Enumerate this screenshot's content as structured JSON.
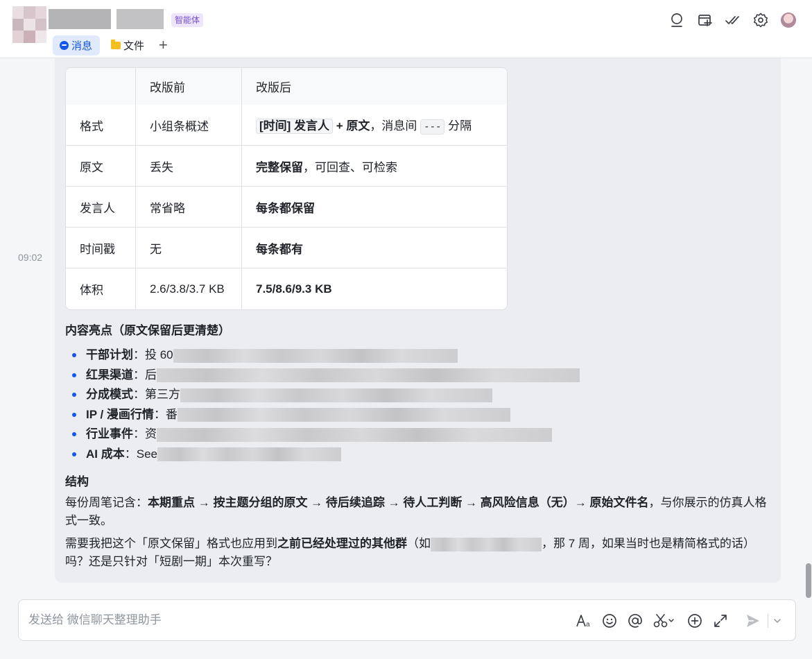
{
  "header": {
    "badge": "智能体",
    "tabs": [
      {
        "label": "消息",
        "active": true
      },
      {
        "label": "文件",
        "active": false
      }
    ],
    "add_tab": "+",
    "icons": [
      "search-icon",
      "add-window-icon",
      "check-icon",
      "settings-icon",
      "user-avatar"
    ]
  },
  "chat": {
    "timestamp": "09:02",
    "table": {
      "headers": [
        "",
        "改版前",
        "改版后"
      ],
      "rows": [
        {
          "label": "格式",
          "before": "小组条概述",
          "after_code1": "[时间] 发言人",
          "after_plus": " + ",
          "after_bold": "原文",
          "after_text": "，消息间 ",
          "after_code2": "---",
          "after_tail": " 分隔"
        },
        {
          "label": "原文",
          "before": "丢失",
          "after_bold": "完整保留",
          "after_text": "，可回查、可检索"
        },
        {
          "label": "发言人",
          "before": "常省略",
          "after_bold": "每条都保留"
        },
        {
          "label": "时间戳",
          "before": "无",
          "after_bold": "每条都有"
        },
        {
          "label": "体积",
          "before": "2.6/3.8/3.7 KB",
          "after_bold": "7.5/8.6/9.3 KB"
        }
      ]
    },
    "highlights": {
      "title": "内容亮点（原文保留后更清楚）",
      "items": [
        {
          "label": "干部计划",
          "text": "：投 60"
        },
        {
          "label": "红果渠道",
          "text": "：后"
        },
        {
          "label": "分成模式",
          "text": "：第三方"
        },
        {
          "label": "IP / 漫画行情",
          "text": "：番"
        },
        {
          "label": "行业事件",
          "text": "：资"
        },
        {
          "label": "AI 成本",
          "text": "：See"
        }
      ]
    },
    "structure": {
      "title": "结构",
      "prefix": "每份周笔记含：",
      "chain": "本期重点 → 按主题分组的原文 → 待后续追踪 → 待人工判断 → 高风险信息（无）→ 原始文件名",
      "suffix": "，与你展示的仿真人格式一致。"
    },
    "question": {
      "p1": "需要我把这个「原文保留」格式也应用到",
      "bold": "之前已经处理过的其他群",
      "p2": "（如",
      "p3": "，那 7 周，如果当时也是精简格式的话）吗？还是只针对「短剧一期」本次重写？"
    }
  },
  "input": {
    "placeholder": "发送给 微信聊天整理助手",
    "value": ""
  },
  "toolbar_icons": [
    "font-icon",
    "emoji-icon",
    "mention-icon",
    "scissors-icon",
    "add-icon",
    "expand-icon",
    "send-icon",
    "send-options-icon"
  ]
}
